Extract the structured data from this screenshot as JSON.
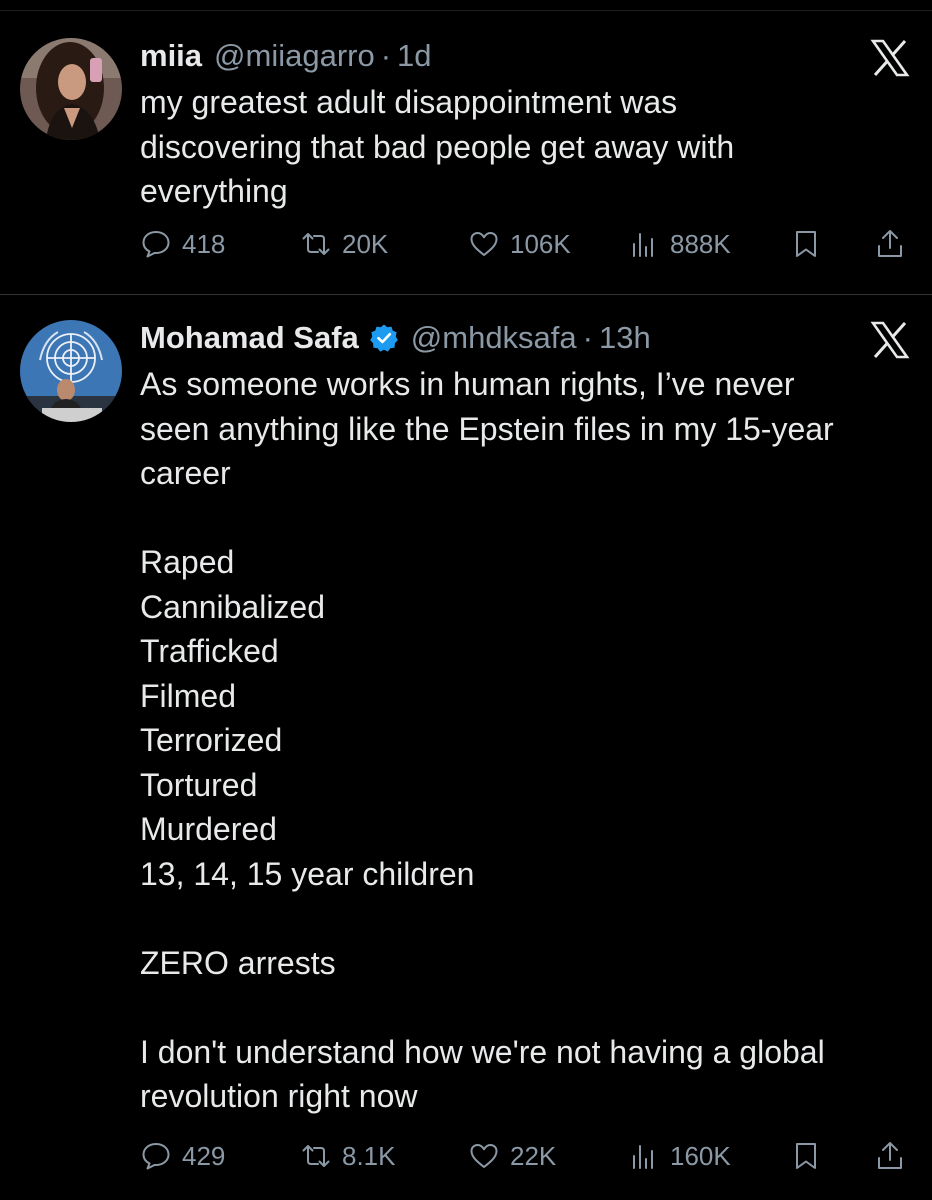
{
  "tweets": [
    {
      "author": {
        "name": "miia",
        "handle": "@miiagarro",
        "verified": false
      },
      "separator": "·",
      "age": "1d",
      "text_lines": [
        "my greatest adult disappointment was",
        "discovering that bad people get away with",
        "everything"
      ],
      "stats": {
        "replies": "418",
        "retweets": "20K",
        "likes": "106K",
        "views": "888K"
      }
    },
    {
      "author": {
        "name": "Mohamad Safa",
        "handle": "@mhdksafa",
        "verified": true
      },
      "separator": "·",
      "age": "13h",
      "text_lines": [
        "As someone works in human rights, I’ve never",
        "seen anything like the Epstein files in my 15-year",
        "career",
        "",
        "Raped",
        "Cannibalized",
        "Trafficked",
        "Filmed",
        "Terrorized",
        "Tortured",
        "Murdered",
        "13, 14, 15 year children",
        "",
        "ZERO arrests",
        "",
        "I don't understand how we're not having a global",
        "revolution right now"
      ],
      "stats": {
        "replies": "429",
        "retweets": "8.1K",
        "likes": "22K",
        "views": "160K"
      }
    }
  ],
  "icons": {
    "platform_logo": "x-logo-icon",
    "reply": "speech-bubble-icon",
    "retweet": "retweet-arrows-icon",
    "like": "heart-icon",
    "views": "bar-chart-icon",
    "bookmark": "bookmark-icon",
    "share": "share-upload-icon",
    "verified": "verified-badge-icon"
  },
  "colors": {
    "background": "#000000",
    "text": "#e7e9ea",
    "secondary_text": "#8b98a5",
    "verified_blue": "#1d9bf0",
    "divider": "#2f3336"
  }
}
